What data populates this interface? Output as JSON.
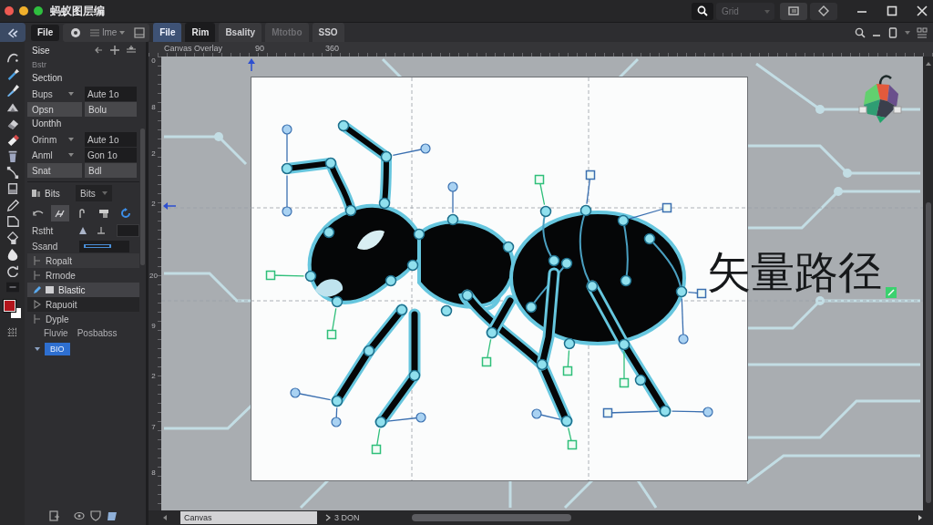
{
  "window": {
    "title": "蚂蚁图层编"
  },
  "title_bar": {
    "view_select": {
      "placeholder": "Grid"
    }
  },
  "toolbar": {
    "file_button": "File",
    "menu": {
      "label": "lme"
    },
    "tabs": [
      {
        "label": "File",
        "selected": true,
        "disabled": false
      },
      {
        "label": "Rim",
        "selected": false,
        "disabled": false
      },
      {
        "label": "Bsality",
        "selected": false,
        "disabled": false
      },
      {
        "label": "Mtotbo",
        "selected": false,
        "disabled": true
      },
      {
        "label": "SSO",
        "selected": false,
        "disabled": false
      }
    ]
  },
  "swatches": [
    {
      "color": "#b3141b"
    },
    {
      "color": "#ffffff"
    }
  ],
  "panel": {
    "title": "Sise",
    "subtitle": "Bstr",
    "sections": [
      {
        "heading": "Section",
        "rows": [
          {
            "kind": "select",
            "label": "Bups",
            "value": "Aute 1o"
          },
          {
            "kind": "buttons",
            "buttons": [
              "Opsn",
              "Bolu"
            ]
          }
        ]
      },
      {
        "heading": "Uonthh",
        "rows": [
          {
            "kind": "select",
            "label": "Orinm",
            "value": "Aute 1o"
          },
          {
            "kind": "select",
            "label": "Anml",
            "value": "Gon 1o"
          },
          {
            "kind": "buttons",
            "buttons": [
              "Snat",
              "Bdl"
            ]
          }
        ]
      }
    ],
    "brush": {
      "label": "Bits",
      "dropdown": "Bits",
      "modes": [
        {
          "selected": false
        },
        {
          "selected": true
        },
        {
          "selected": false
        },
        {
          "selected": false
        },
        {
          "selected": false
        }
      ]
    },
    "stroke": {
      "label": "Rstht"
    },
    "stroke_style": {
      "label": "Ssand"
    },
    "layers": [
      {
        "name": "Ropalt",
        "kind": "layer",
        "selected": false
      },
      {
        "name": "Rrnode",
        "kind": "layer",
        "selected": false
      },
      {
        "name": "Blastic",
        "kind": "layer",
        "selected": true
      },
      {
        "name": "Rapuoit",
        "kind": "group",
        "selected": false
      },
      {
        "name": "Dyple",
        "kind": "layer",
        "selected": false
      }
    ],
    "layer_info": {
      "label": "Fluvie",
      "value": "Posbabss"
    },
    "tag": {
      "label": "BIO"
    }
  },
  "canvas": {
    "ruler_labels": [
      "Canvas Overlay",
      "90",
      "360"
    ],
    "left_ruler_labels": [
      "0",
      "8",
      "2",
      "2",
      "20",
      "9",
      "2",
      "7",
      "8"
    ],
    "caption": "矢量路径"
  },
  "status_bar": {
    "tab": "Canvas",
    "info": "3 DON"
  }
}
